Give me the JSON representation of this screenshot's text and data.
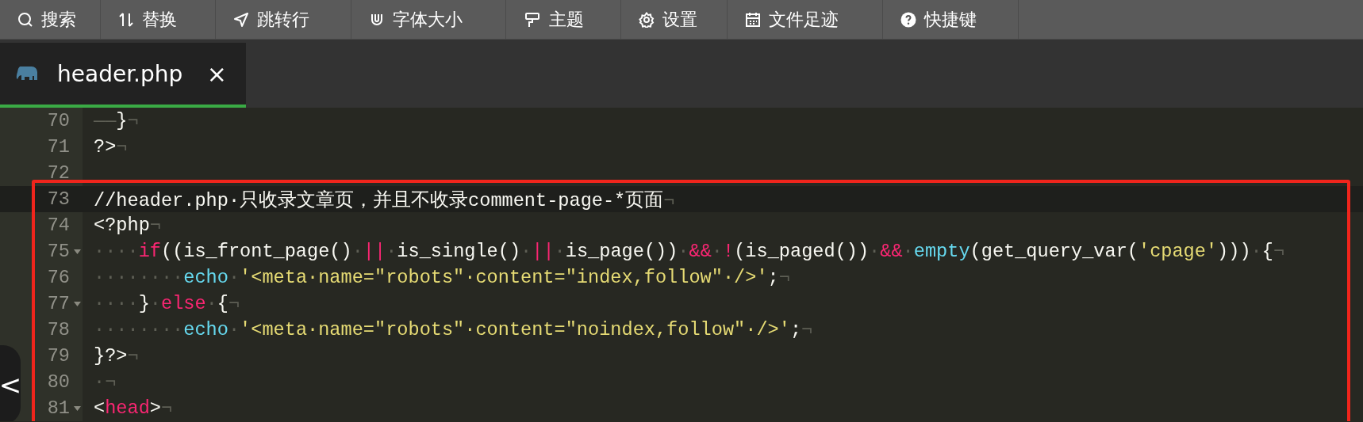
{
  "toolbar": [
    {
      "label": "搜索",
      "kind": "search"
    },
    {
      "label": "替换",
      "kind": "replace"
    },
    {
      "label": "跳转行",
      "kind": "goto"
    },
    {
      "label": "字体大小",
      "kind": "font"
    },
    {
      "label": "主题",
      "kind": "theme"
    },
    {
      "label": "设置",
      "kind": "settings"
    },
    {
      "label": "文件足迹",
      "kind": "history"
    },
    {
      "label": "快捷键",
      "kind": "help"
    }
  ],
  "tabs": [
    {
      "label": "header.php",
      "close": "×",
      "selected": true
    }
  ],
  "editor": {
    "lines": [
      {
        "number": "70",
        "current": false,
        "fold": false,
        "tokens": [
          {
            "kind": "ws",
            "text": "——"
          },
          {
            "kind": "plain",
            "text": "}"
          },
          {
            "kind": "ws",
            "text": "¬"
          }
        ]
      },
      {
        "number": "71",
        "current": false,
        "fold": false,
        "tokens": [
          {
            "kind": "plain",
            "text": "?>"
          },
          {
            "kind": "ws",
            "text": "¬"
          }
        ]
      },
      {
        "number": "72",
        "current": false,
        "fold": false
      },
      {
        "number": "73",
        "current": true,
        "fold": false,
        "tokens": [
          {
            "kind": "plain",
            "text": "//header.php·只收录文章页，并且不收录comment-page-*页面"
          },
          {
            "kind": "ws",
            "text": "¬"
          }
        ]
      },
      {
        "number": "74",
        "current": false,
        "fold": false,
        "tokens": [
          {
            "kind": "plain",
            "text": "<?php"
          },
          {
            "kind": "ws",
            "text": "¬"
          }
        ]
      },
      {
        "number": "75",
        "current": false,
        "fold": true,
        "tokens": [
          {
            "kind": "ws",
            "text": "····"
          },
          {
            "kind": "keyword",
            "text": "if"
          },
          {
            "kind": "plain",
            "text": "((is_front_page()"
          },
          {
            "kind": "ws",
            "text": "·"
          },
          {
            "kind": "keyword",
            "text": "||"
          },
          {
            "kind": "ws",
            "text": "·"
          },
          {
            "kind": "plain",
            "text": "is_single()"
          },
          {
            "kind": "ws",
            "text": "·"
          },
          {
            "kind": "keyword",
            "text": "||"
          },
          {
            "kind": "ws",
            "text": "·"
          },
          {
            "kind": "plain",
            "text": "is_page())"
          },
          {
            "kind": "ws",
            "text": "·"
          },
          {
            "kind": "keyword",
            "text": "&&"
          },
          {
            "kind": "ws",
            "text": "·"
          },
          {
            "kind": "keyword",
            "text": "!"
          },
          {
            "kind": "plain",
            "text": "(is_paged())"
          },
          {
            "kind": "ws",
            "text": "·"
          },
          {
            "kind": "keyword",
            "text": "&&"
          },
          {
            "kind": "ws",
            "text": "·"
          },
          {
            "kind": "func",
            "text": "empty"
          },
          {
            "kind": "plain",
            "text": "(get_query_var("
          },
          {
            "kind": "string",
            "text": "'cpage'"
          },
          {
            "kind": "plain",
            "text": ")))"
          },
          {
            "kind": "ws",
            "text": "·"
          },
          {
            "kind": "plain",
            "text": "{"
          },
          {
            "kind": "ws",
            "text": "¬"
          }
        ]
      },
      {
        "number": "76",
        "current": false,
        "fold": false,
        "tokens": [
          {
            "kind": "ws",
            "text": "········"
          },
          {
            "kind": "func",
            "text": "echo"
          },
          {
            "kind": "ws",
            "text": "·"
          },
          {
            "kind": "string",
            "text": "'<meta·name=\"robots\"·content=\"index,follow\"·/>'"
          },
          {
            "kind": "plain",
            "text": ";"
          },
          {
            "kind": "ws",
            "text": "¬"
          }
        ]
      },
      {
        "number": "77",
        "current": false,
        "fold": true,
        "tokens": [
          {
            "kind": "ws",
            "text": "····"
          },
          {
            "kind": "plain",
            "text": "}"
          },
          {
            "kind": "ws",
            "text": "·"
          },
          {
            "kind": "keyword",
            "text": "else"
          },
          {
            "kind": "ws",
            "text": "·"
          },
          {
            "kind": "plain",
            "text": "{"
          },
          {
            "kind": "ws",
            "text": "¬"
          }
        ]
      },
      {
        "number": "78",
        "current": false,
        "fold": false,
        "tokens": [
          {
            "kind": "ws",
            "text": "········"
          },
          {
            "kind": "func",
            "text": "echo"
          },
          {
            "kind": "ws",
            "text": "·"
          },
          {
            "kind": "string",
            "text": "'<meta·name=\"robots\"·content=\"noindex,follow\"·/>'"
          },
          {
            "kind": "plain",
            "text": ";"
          },
          {
            "kind": "ws",
            "text": "¬"
          }
        ]
      },
      {
        "number": "79",
        "current": false,
        "fold": false,
        "tokens": [
          {
            "kind": "plain",
            "text": "}?>"
          },
          {
            "kind": "ws",
            "text": "¬"
          }
        ]
      },
      {
        "number": "80",
        "current": false,
        "fold": false,
        "tokens": [
          {
            "kind": "ws",
            "text": "·¬"
          }
        ]
      },
      {
        "number": "81",
        "current": false,
        "fold": true,
        "tokens": [
          {
            "kind": "plain",
            "text": "<"
          },
          {
            "kind": "keyword",
            "text": "head"
          },
          {
            "kind": "plain",
            "text": ">"
          },
          {
            "kind": "ws",
            "text": "¬"
          }
        ]
      }
    ],
    "collapse_button": "<"
  }
}
